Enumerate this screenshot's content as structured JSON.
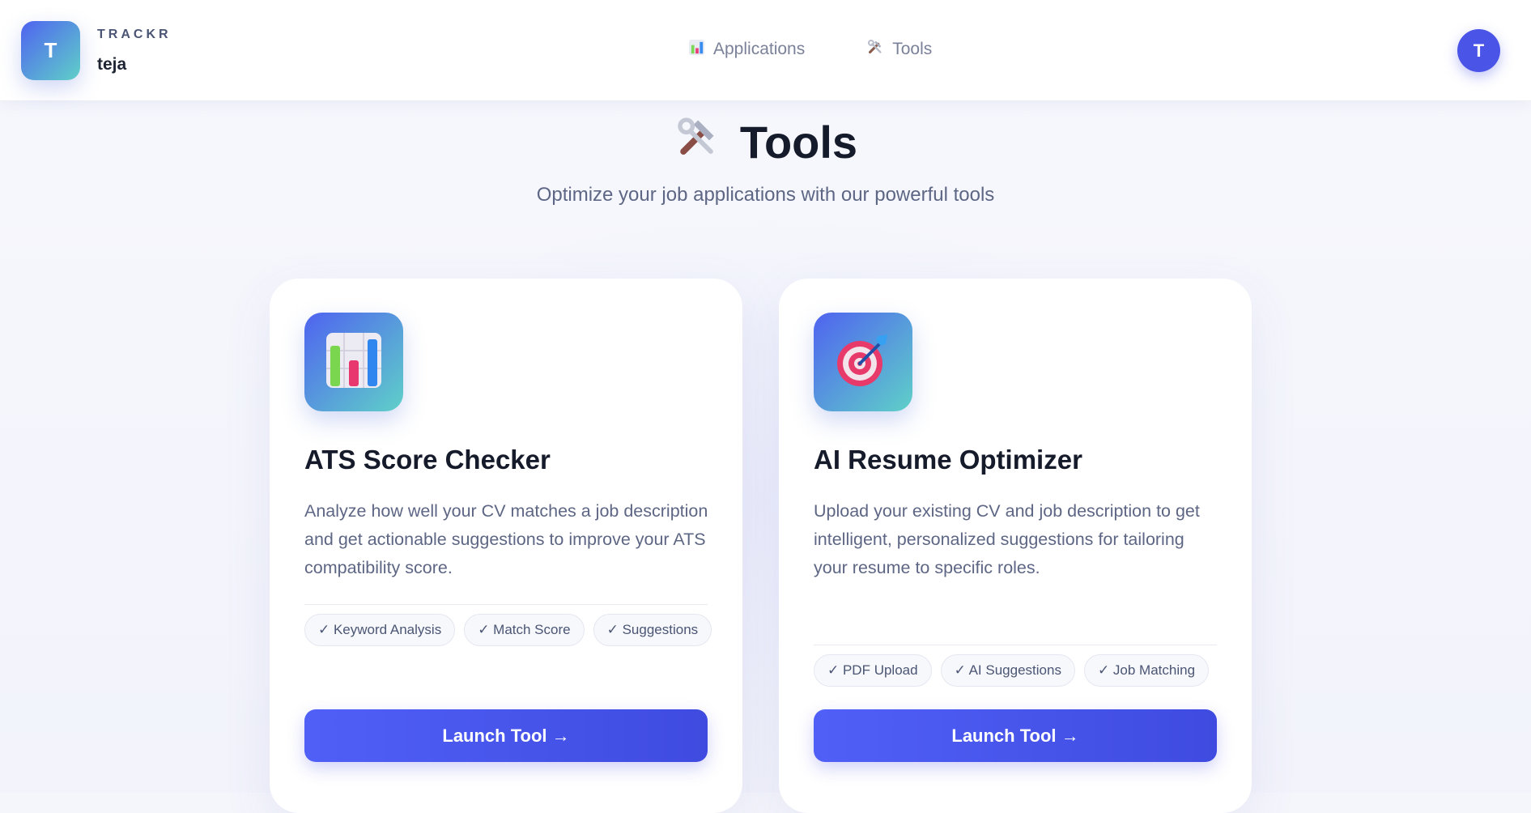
{
  "header": {
    "brand_initial": "T",
    "brand_name": "TRACKR",
    "user_name": "teja",
    "nav": [
      {
        "label": "Applications",
        "icon": "bar-chart-icon"
      },
      {
        "label": "Tools",
        "icon": "hammer-wrench-icon"
      }
    ],
    "avatar_initial": "T"
  },
  "page": {
    "title": "Tools",
    "title_icon": "hammer-wrench-icon",
    "subtitle": "Optimize your job applications with our powerful tools"
  },
  "cards": [
    {
      "icon": "bar-chart-icon",
      "title": "ATS Score Checker",
      "description": "Analyze how well your CV matches a job description and get actionable suggestions to improve your ATS compatibility score.",
      "tags": [
        "✓ Keyword Analysis",
        "✓ Match Score",
        "✓ Suggestions"
      ],
      "button_label": "Launch Tool →"
    },
    {
      "icon": "target-dart-icon",
      "title": "AI Resume Optimizer",
      "description": "Upload your existing CV and job description to get intelligent, personalized suggestions for tailoring your resume to specific roles.",
      "tags": [
        "✓ PDF Upload",
        "✓ AI Suggestions",
        "✓ Job Matching"
      ],
      "button_label": "Launch Tool →"
    }
  ],
  "colors": {
    "accent": "#4a55e8",
    "gradient_start": "#4f63f0",
    "gradient_end": "#5fd0c8"
  }
}
